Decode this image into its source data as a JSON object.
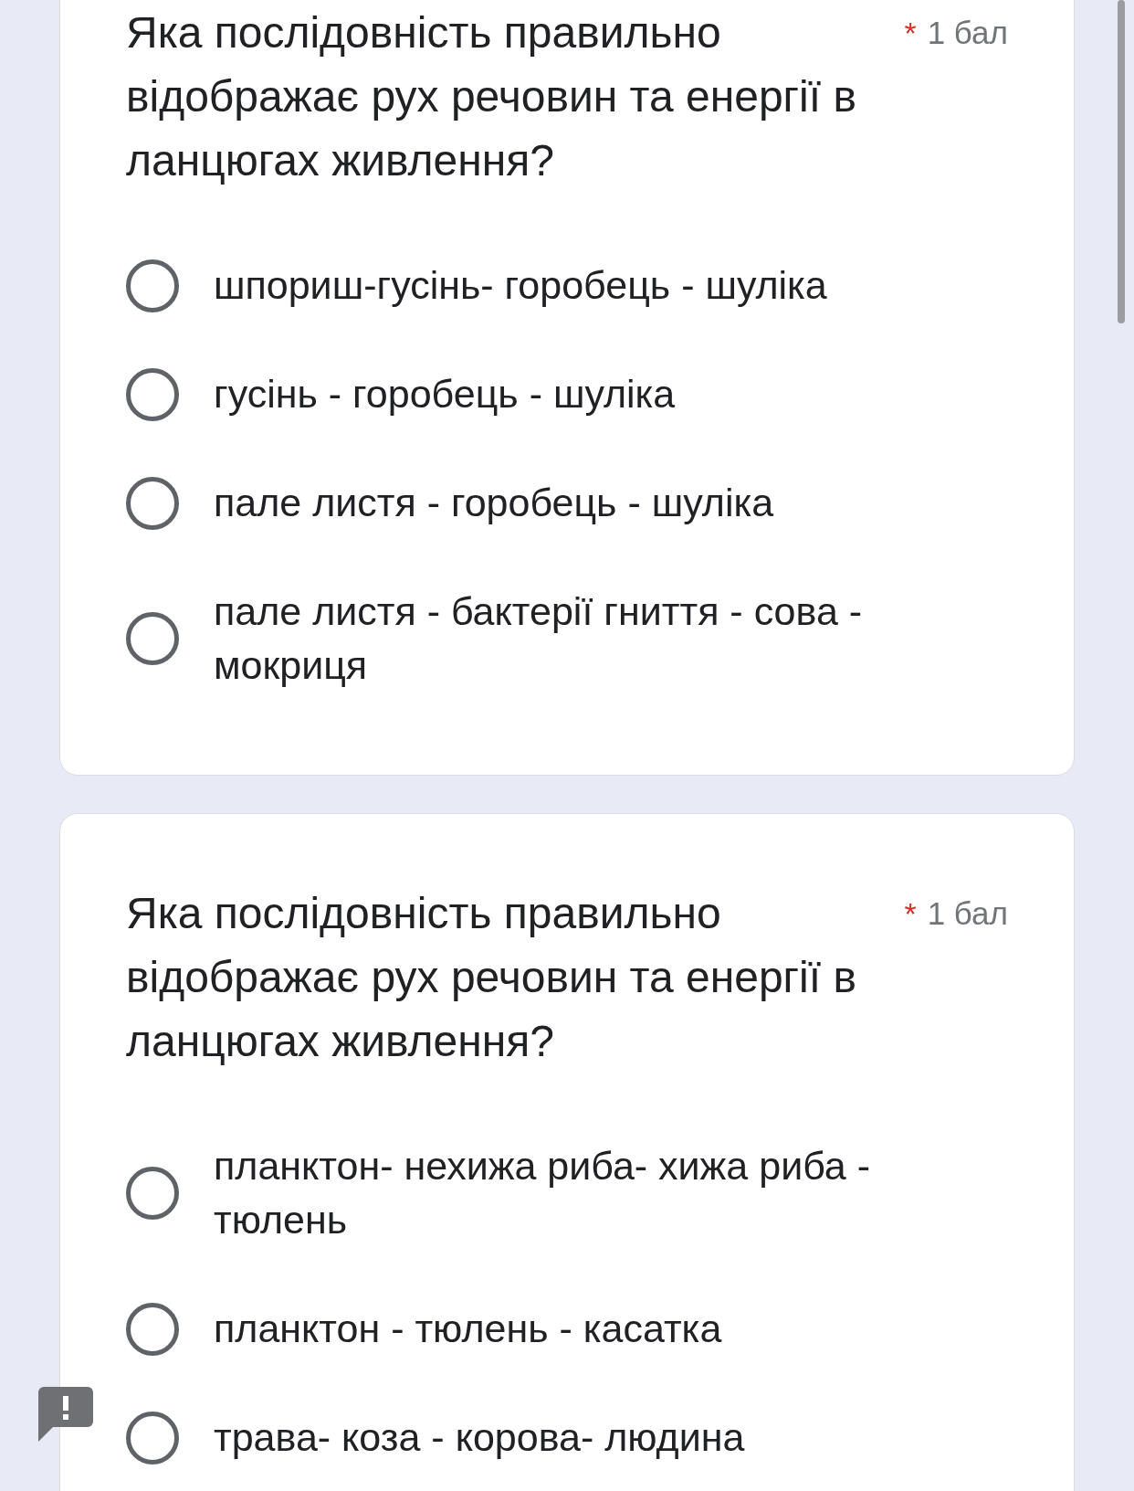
{
  "questions": [
    {
      "title": "Яка послідовність правильно відображає рух речовин та енергії в ланцюгах живлення?",
      "required_mark": "*",
      "points": "1 бал",
      "options": [
        {
          "label": "шпориш-гусінь- горобець - шуліка",
          "selected": false
        },
        {
          "label": "гусінь - горобець - шуліка",
          "selected": false
        },
        {
          "label": "пале листя - горобець - шуліка",
          "selected": false
        },
        {
          "label": "пале листя - бактерії гниття - сова - мокриця",
          "selected": false
        }
      ]
    },
    {
      "title": "Яка послідовність правильно відображає рух речовин та енергії в ланцюгах живлення?",
      "required_mark": "*",
      "points": "1 бал",
      "options": [
        {
          "label": "планктон- нехижа риба- хижа риба - тюлень",
          "selected": false
        },
        {
          "label": "планктон - тюлень - касатка",
          "selected": false
        },
        {
          "label": "трава- коза - корова- людина",
          "selected": false
        }
      ]
    }
  ]
}
